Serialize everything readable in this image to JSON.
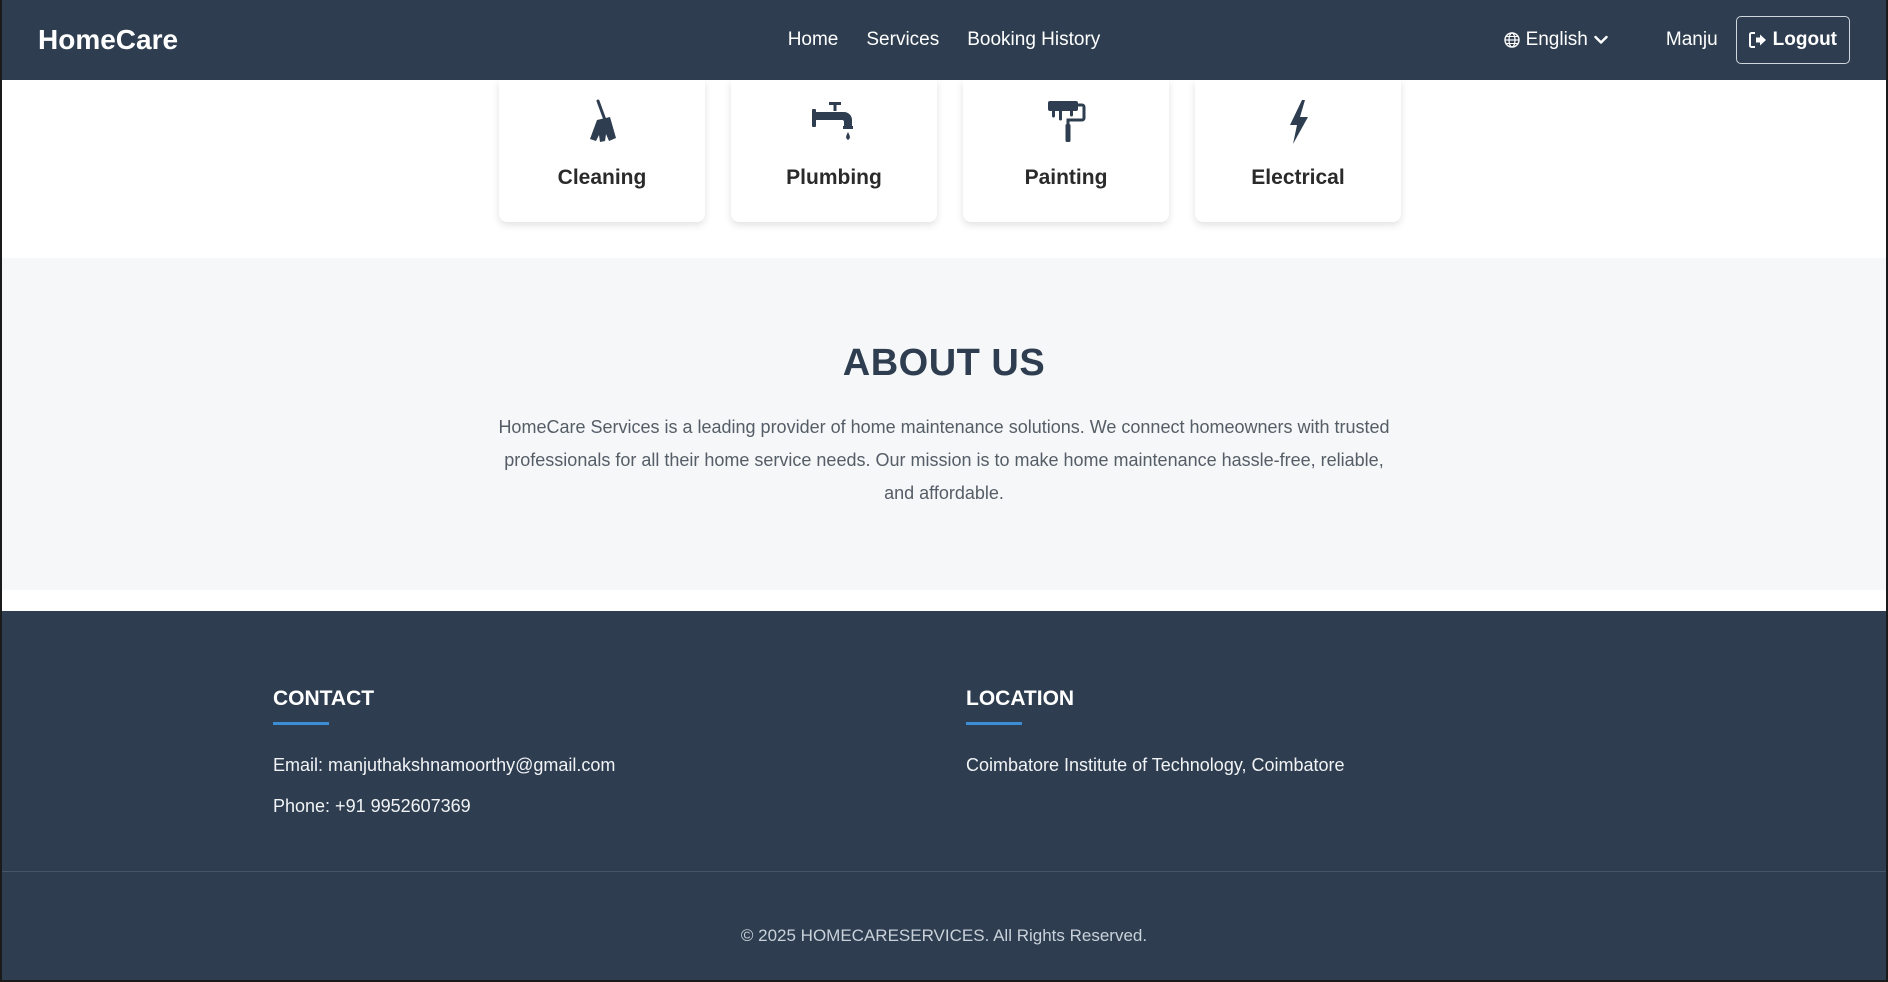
{
  "brand": "HomeCare",
  "nav": {
    "links": [
      "Home",
      "Services",
      "Booking History"
    ],
    "language": "English",
    "user": "Manju",
    "logout": "Logout"
  },
  "services": [
    {
      "label": "Cleaning",
      "icon": "broom-icon"
    },
    {
      "label": "Plumbing",
      "icon": "faucet-icon"
    },
    {
      "label": "Painting",
      "icon": "paint-roller-icon"
    },
    {
      "label": "Electrical",
      "icon": "bolt-icon"
    }
  ],
  "about": {
    "title": "ABOUT US",
    "text": "HomeCare Services is a leading provider of home maintenance solutions. We connect homeowners with trusted professionals for all their home service needs. Our mission is to make home maintenance hassle-free, reliable, and affordable."
  },
  "footer": {
    "contact_title": "CONTACT",
    "email": "Email: manjuthakshnamoorthy@gmail.com",
    "phone": "Phone: +91 9952607369",
    "location_title": "LOCATION",
    "location": "Coimbatore Institute of Technology, Coimbatore",
    "copyright": "© 2025 HOMECARESERVICES. All Rights Reserved."
  },
  "colors": {
    "navbar": "#2e3e50",
    "accent": "#3b8ed3",
    "about_bg": "#f6f7f9"
  }
}
